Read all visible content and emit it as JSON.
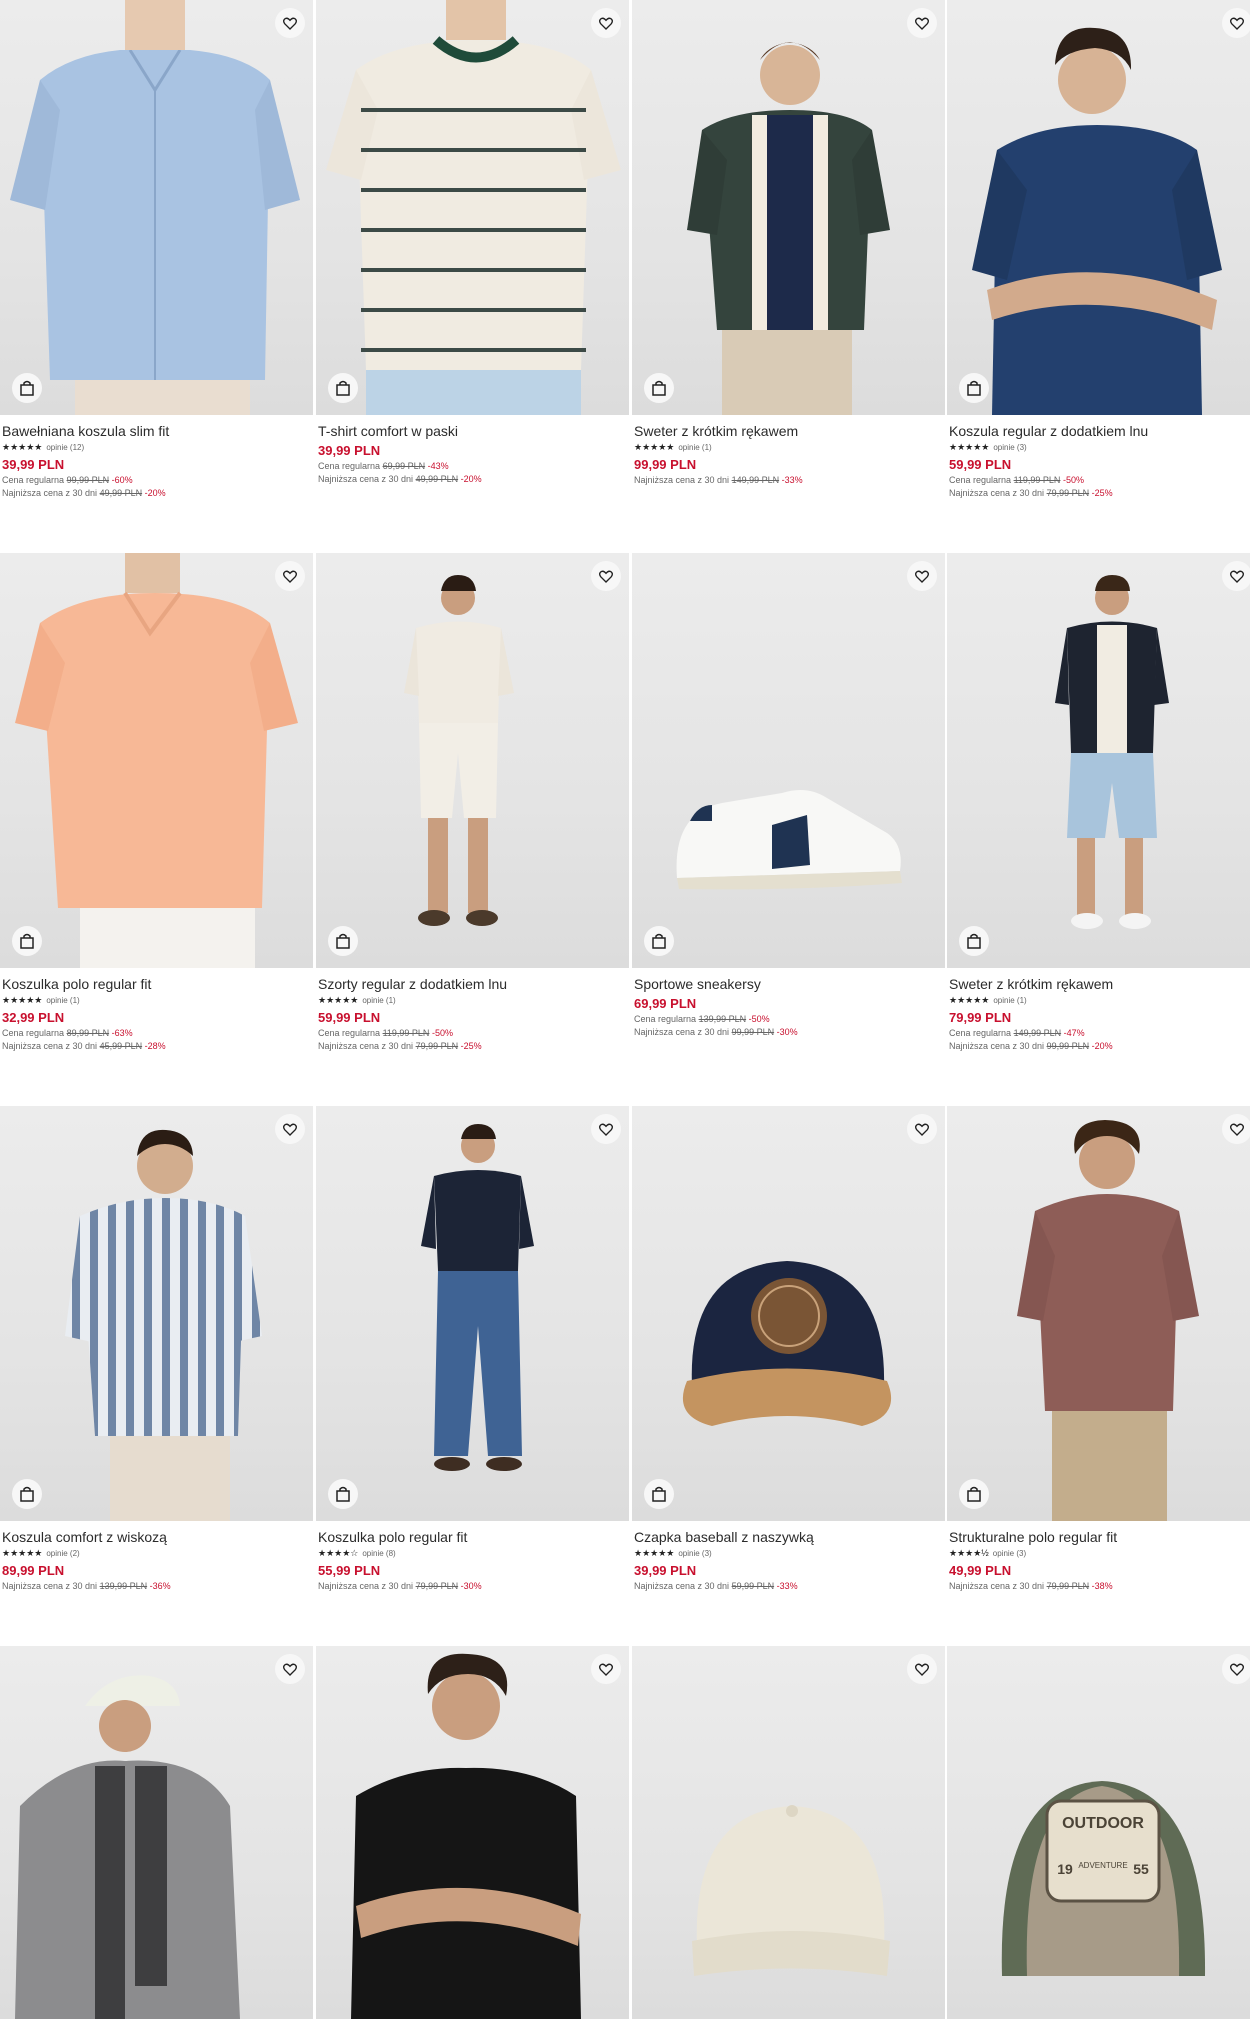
{
  "products": [
    {
      "name": "Bawełniana koszula slim fit",
      "stars": "★★★★★",
      "reviews": "opinie (12)",
      "price": "39,99 PLN",
      "regular_label": "Cena regularna",
      "regular_old": "99,99 PLN",
      "regular_disc": "-60%",
      "lowest_label": "Najniższa cena z 30 dni",
      "lowest_old": "49,99 PLN",
      "lowest_disc": "-20%"
    },
    {
      "name": "T-shirt comfort w paski",
      "stars": "",
      "reviews": "",
      "price": "39,99 PLN",
      "regular_label": "Cena regularna",
      "regular_old": "69,99 PLN",
      "regular_disc": "-43%",
      "lowest_label": "Najniższa cena z 30 dni",
      "lowest_old": "49,99 PLN",
      "lowest_disc": "-20%"
    },
    {
      "name": "Sweter z krótkim rękawem",
      "stars": "★★★★★",
      "reviews": "opinie (1)",
      "price": "99,99 PLN",
      "regular_label": "",
      "regular_old": "",
      "regular_disc": "",
      "lowest_label": "Najniższa cena z 30 dni",
      "lowest_old": "149,99 PLN",
      "lowest_disc": "-33%"
    },
    {
      "name": "Koszula regular z dodatkiem lnu",
      "stars": "★★★★★",
      "reviews": "opinie (3)",
      "price": "59,99 PLN",
      "regular_label": "Cena regularna",
      "regular_old": "119,99 PLN",
      "regular_disc": "-50%",
      "lowest_label": "Najniższa cena z 30 dni",
      "lowest_old": "79,99 PLN",
      "lowest_disc": "-25%"
    },
    {
      "name": "Koszulka polo regular fit",
      "stars": "★★★★★",
      "reviews": "opinie (1)",
      "price": "32,99 PLN",
      "regular_label": "Cena regularna",
      "regular_old": "89,99 PLN",
      "regular_disc": "-63%",
      "lowest_label": "Najniższa cena z 30 dni",
      "lowest_old": "45,99 PLN",
      "lowest_disc": "-28%"
    },
    {
      "name": "Szorty regular z dodatkiem lnu",
      "stars": "★★★★★",
      "reviews": "opinie (1)",
      "price": "59,99 PLN",
      "regular_label": "Cena regularna",
      "regular_old": "119,99 PLN",
      "regular_disc": "-50%",
      "lowest_label": "Najniższa cena z 30 dni",
      "lowest_old": "79,99 PLN",
      "lowest_disc": "-25%"
    },
    {
      "name": "Sportowe sneakersy",
      "stars": "",
      "reviews": "",
      "price": "69,99 PLN",
      "regular_label": "Cena regularna",
      "regular_old": "139,99 PLN",
      "regular_disc": "-50%",
      "lowest_label": "Najniższa cena z 30 dni",
      "lowest_old": "99,99 PLN",
      "lowest_disc": "-30%"
    },
    {
      "name": "Sweter z krótkim rękawem",
      "stars": "★★★★★",
      "reviews": "opinie (1)",
      "price": "79,99 PLN",
      "regular_label": "Cena regularna",
      "regular_old": "149,99 PLN",
      "regular_disc": "-47%",
      "lowest_label": "Najniższa cena z 30 dni",
      "lowest_old": "99,99 PLN",
      "lowest_disc": "-20%"
    },
    {
      "name": "Koszula comfort z wiskozą",
      "stars": "★★★★★",
      "reviews": "opinie (2)",
      "price": "89,99 PLN",
      "regular_label": "",
      "regular_old": "",
      "regular_disc": "",
      "lowest_label": "Najniższa cena z 30 dni",
      "lowest_old": "139,99 PLN",
      "lowest_disc": "-36%"
    },
    {
      "name": "Koszulka polo regular fit",
      "stars": "★★★★☆",
      "reviews": "opinie (8)",
      "price": "55,99 PLN",
      "regular_label": "",
      "regular_old": "",
      "regular_disc": "",
      "lowest_label": "Najniższa cena z 30 dni",
      "lowest_old": "79,99 PLN",
      "lowest_disc": "-30%"
    },
    {
      "name": "Czapka baseball z naszywką",
      "stars": "★★★★★",
      "reviews": "opinie (3)",
      "price": "39,99 PLN",
      "regular_label": "",
      "regular_old": "",
      "regular_disc": "",
      "lowest_label": "Najniższa cena z 30 dni",
      "lowest_old": "59,99 PLN",
      "lowest_disc": "-33%"
    },
    {
      "name": "Strukturalne polo regular fit",
      "stars": "★★★★½",
      "reviews": "opinie (3)",
      "price": "49,99 PLN",
      "regular_label": "",
      "regular_old": "",
      "regular_disc": "",
      "lowest_label": "Najniższa cena z 30 dni",
      "lowest_old": "79,99 PLN",
      "lowest_disc": "-38%"
    }
  ],
  "patch_lettering": {
    "top": "OUTDOOR",
    "middle": "ADVENTURE",
    "left": "19",
    "right": "55"
  },
  "colors": {
    "sale_red": "#c8102e",
    "text": "#2b2b2b",
    "muted": "#666666",
    "image_bg": "#e8e8e8"
  },
  "icons": {
    "wishlist": "heart-icon",
    "quick_add": "shopping-bag-icon"
  }
}
